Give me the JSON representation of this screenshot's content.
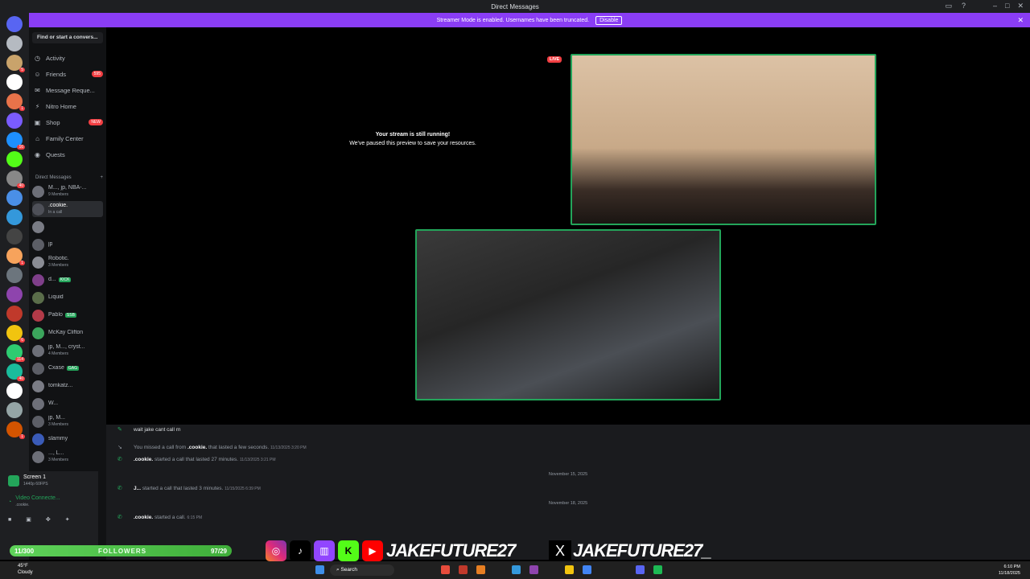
{
  "window": {
    "title": "Direct Messages"
  },
  "banner": {
    "text": "Streamer Mode is enabled. Usernames have been truncated.",
    "button": "Disable"
  },
  "servers": [
    {
      "color": "#5865f2",
      "badge": ""
    },
    {
      "color": "#b5bac1",
      "badge": ""
    },
    {
      "color": "#c9a36b",
      "badge": "5"
    },
    {
      "color": "#ffffff",
      "badge": ""
    },
    {
      "color": "#e8734a",
      "badge": "1"
    },
    {
      "color": "#7a5cff",
      "badge": ""
    },
    {
      "color": "#1e90ff",
      "badge": "16"
    },
    {
      "color": "#53fc18",
      "badge": ""
    },
    {
      "color": "#888888",
      "badge": "40"
    },
    {
      "color": "#4a8fe7",
      "badge": ""
    },
    {
      "color": "#3498db",
      "badge": ""
    },
    {
      "color": "#444444",
      "badge": ""
    },
    {
      "color": "#f7a35c",
      "badge": "1"
    },
    {
      "color": "#6c757d",
      "badge": ""
    },
    {
      "color": "#8e44ad",
      "badge": ""
    },
    {
      "color": "#c0392b",
      "badge": ""
    },
    {
      "color": "#f1c40f",
      "badge": "6"
    },
    {
      "color": "#2ecc71",
      "badge": "114"
    },
    {
      "color": "#1abc9c",
      "badge": "40"
    },
    {
      "color": "#ffffff",
      "badge": ""
    },
    {
      "color": "#95a5a6",
      "badge": ""
    },
    {
      "color": "#d35400",
      "badge": "1"
    }
  ],
  "sidebar": {
    "search_placeholder": "Find or start a convers...",
    "nav": [
      {
        "label": "Activity",
        "icon": "◷",
        "pill": ""
      },
      {
        "label": "Friends",
        "icon": "☺",
        "pill": "595"
      },
      {
        "label": "Message Reque...",
        "icon": "✉",
        "pill": ""
      },
      {
        "label": "Nitro Home",
        "icon": "⚡",
        "pill": ""
      },
      {
        "label": "Shop",
        "icon": "▣",
        "pill": "NEW"
      },
      {
        "label": "Family Center",
        "icon": "⌂",
        "pill": ""
      },
      {
        "label": "Quests",
        "icon": "◉",
        "pill": ""
      }
    ],
    "dm_header": "Direct Messages",
    "dms": [
      {
        "name": "M..., jp, NBA-...",
        "sub": "9 Members",
        "tag": "",
        "sel": false
      },
      {
        "name": ".cookie.",
        "sub": "In a call",
        "tag": "",
        "sel": true
      },
      {
        "name": "",
        "sub": "",
        "tag": "",
        "sel": false
      },
      {
        "name": "jp",
        "sub": "",
        "tag": "",
        "sel": false
      },
      {
        "name": "Robotic.",
        "sub": "3 Members",
        "tag": "",
        "sel": false
      },
      {
        "name": "d...",
        "sub": "",
        "tag": "KICK",
        "sel": false
      },
      {
        "name": "Liquid",
        "sub": "",
        "tag": "",
        "sel": false
      },
      {
        "name": "Pablo",
        "sub": "",
        "tag": "SSB",
        "sel": false
      },
      {
        "name": "McKay Clifton",
        "sub": "",
        "tag": "",
        "sel": false
      },
      {
        "name": "jp, M..., cryst...",
        "sub": "4 Members",
        "tag": "",
        "sel": false
      },
      {
        "name": "Cxase",
        "sub": "",
        "tag": "GAG",
        "sel": false
      },
      {
        "name": "tomkatz...",
        "sub": "",
        "tag": "",
        "sel": false
      },
      {
        "name": "W...",
        "sub": "",
        "tag": "",
        "sel": false
      },
      {
        "name": "jp, M...",
        "sub": "3 Members",
        "tag": "",
        "sel": false
      },
      {
        "name": "slammy",
        "sub": "",
        "tag": "",
        "sel": false
      },
      {
        "name": "..., L...",
        "sub": "3 Members",
        "tag": "",
        "sel": false
      }
    ]
  },
  "voice": {
    "title": "Screen 1",
    "sub": "1440p 60FPS",
    "status": "Video Connecte...",
    "channel": ".cookie."
  },
  "main": {
    "live": "LIVE",
    "stream_title": "Your stream is still running!",
    "stream_sub": "We've paused this preview to save your resources."
  },
  "chat": {
    "messages": [
      {
        "icon": "✎",
        "user": "",
        "text": "wait jake cant call rn",
        "ts": ""
      },
      {
        "icon": "↘",
        "user": ".cookie.",
        "pre": "You missed a call from",
        "text": "that lasted a few seconds.",
        "ts": "11/13/2025 3:20 PM"
      },
      {
        "icon": "✆",
        "user": ".cookie.",
        "pre": "",
        "text": "started a call that lasted 27 minutes.",
        "ts": "11/13/2025 3:21 PM"
      },
      {
        "icon": "✆",
        "user": "J...",
        "pre": "",
        "text": "started a call that lasted 3 minutes.",
        "ts": "11/15/2025 6:39 PM"
      },
      {
        "icon": "✆",
        "user": ".cookie.",
        "pre": "",
        "text": "started a call.",
        "ts": "6:15 PM"
      }
    ],
    "separators": [
      "November 15, 2025",
      "November 18, 2025"
    ]
  },
  "overlay": {
    "follow_left": "11/300",
    "follow_mid": "FOLLOWERS",
    "follow_right": "97/29",
    "handle": "JAKEFUTURE27",
    "handle2": "JAKEFUTURE27_"
  },
  "taskbar": {
    "weather_temp": "45°F",
    "weather_desc": "Cloudy",
    "search": "Search",
    "time": "6:10 PM",
    "date": "11/18/2025"
  }
}
